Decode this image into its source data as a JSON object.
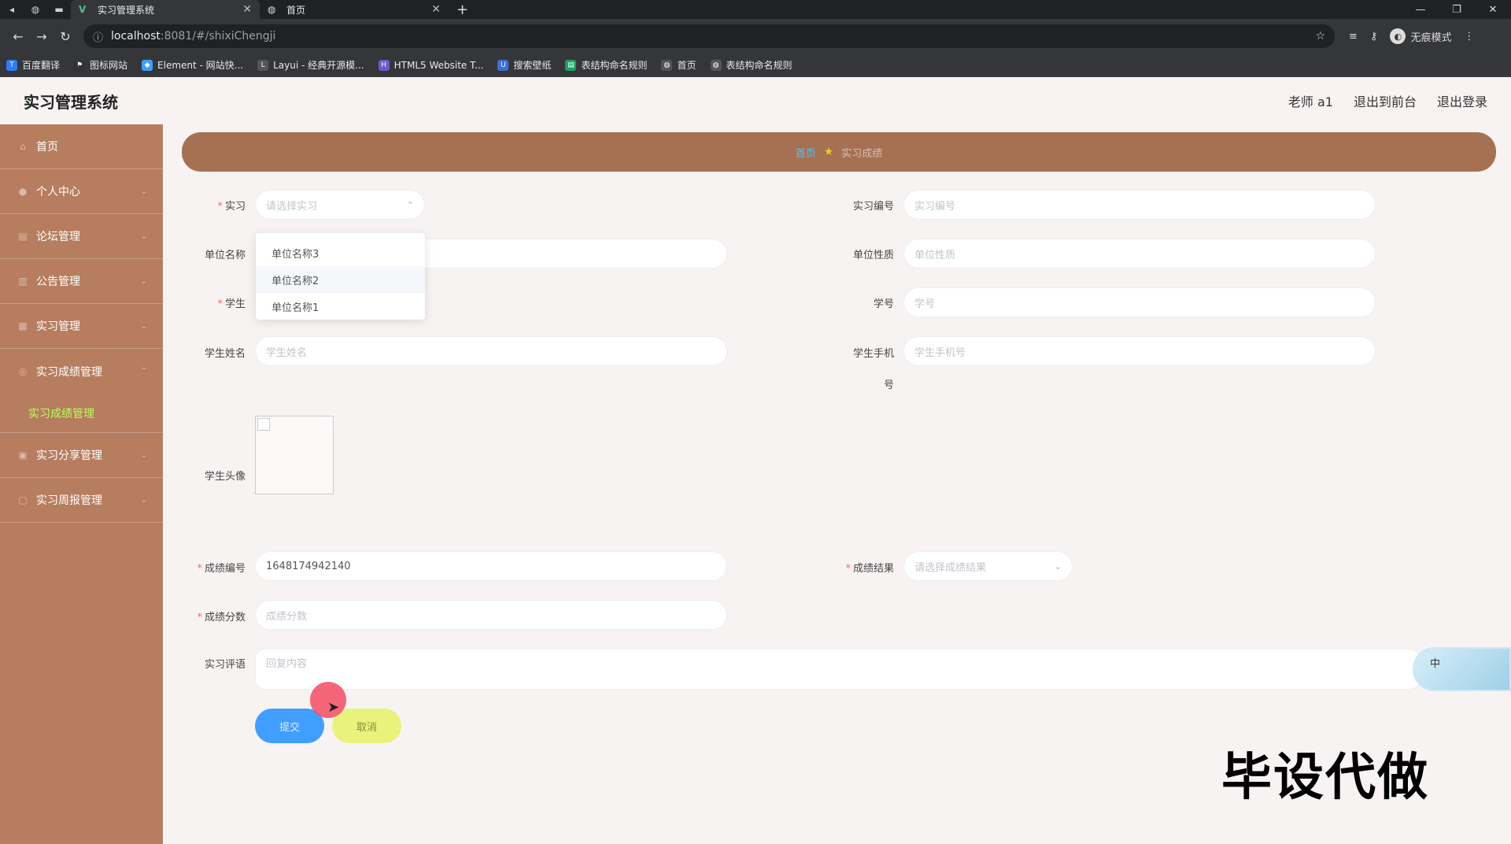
{
  "browser": {
    "tabs": [
      {
        "title": "实习管理系统",
        "active": true
      },
      {
        "title": "首页",
        "active": false
      }
    ],
    "new_tab_label": "+",
    "url_host": "localhost",
    "url_path": ":8081/#/shixiChengji",
    "incognito_label": "无痕模式",
    "bookmarks": [
      "百度翻译",
      "图标网站",
      "Element - 网站快...",
      "Layui - 经典开源模...",
      "HTML5 Website T...",
      "搜索壁纸",
      "表结构命名规则",
      "首页",
      "表结构命名规则"
    ]
  },
  "header": {
    "title": "实习管理系统",
    "user": "老师 a1",
    "exit_front": "退出到前台",
    "logout": "退出登录"
  },
  "sidebar": {
    "items": [
      {
        "label": "首页",
        "icon": "home-icon"
      },
      {
        "label": "个人中心",
        "icon": "user-icon"
      },
      {
        "label": "论坛管理",
        "icon": "forum-icon"
      },
      {
        "label": "公告管理",
        "icon": "notice-icon"
      },
      {
        "label": "实习管理",
        "icon": "internship-icon"
      },
      {
        "label": "实习成绩管理",
        "icon": "score-icon"
      },
      {
        "label": "实习分享管理",
        "icon": "share-icon"
      },
      {
        "label": "实习周报管理",
        "icon": "report-icon"
      }
    ],
    "active_sub": "实习成绩管理"
  },
  "breadcrumb": {
    "home": "首页",
    "current": "实习成绩"
  },
  "form": {
    "shixi_label": "实习",
    "shixi_placeholder": "请选择实习",
    "shixi_no_label": "实习编号",
    "shixi_no_placeholder": "实习编号",
    "unit_name_label": "单位名称",
    "unit_type_label": "单位性质",
    "unit_type_placeholder": "单位性质",
    "student_label": "学生",
    "student_no_label": "学号",
    "student_no_placeholder": "学号",
    "student_name_label": "学生姓名",
    "student_name_placeholder": "学生姓名",
    "student_phone_label_1": "学生手机",
    "student_phone_label_2": "号",
    "student_phone_placeholder": "学生手机号",
    "avatar_label": "学生头像",
    "score_no_label": "成绩编号",
    "score_no_value": "1648174942140",
    "score_result_label": "成绩结果",
    "score_result_placeholder": "请选择成绩结果",
    "score_points_label": "成绩分数",
    "score_points_placeholder": "成绩分数",
    "comment_label": "实习评语",
    "comment_placeholder": "回复内容",
    "submit": "提交",
    "cancel": "取消"
  },
  "dropdown_options": [
    "单位名称3",
    "单位名称2",
    "单位名称1"
  ],
  "ime_label": "中",
  "watermark": "毕设代做"
}
